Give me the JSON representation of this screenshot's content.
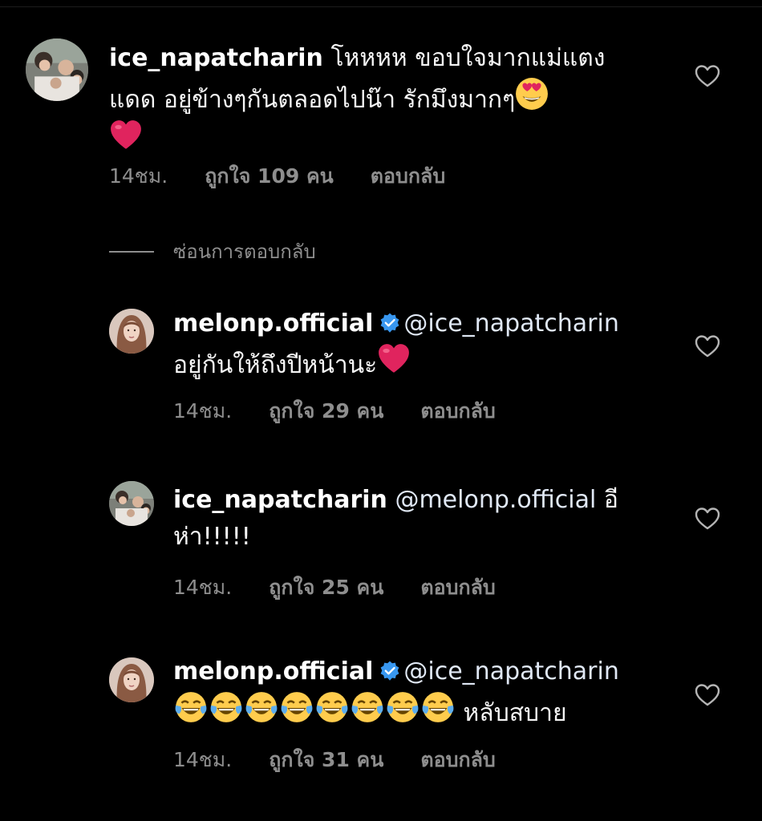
{
  "colors": {
    "background": "#000000",
    "meta_text": "#8e8e8e",
    "verified": "#3897f0",
    "heart_emoji": "#e0245e"
  },
  "comments": [
    {
      "username": "ice_napatcharin",
      "text_line1": " โหหหห ขอบใจมากแม่แตง",
      "text_line2": "แดด  อยู่ข้างๆกันตลอดไปน๊า รักมึงมากๆ",
      "time": "14ชม.",
      "likes": "ถูกใจ 109 คน",
      "reply": "ตอบกลับ",
      "emoji": [
        "heart-eyes",
        "red-heart"
      ]
    },
    {
      "username": "melonp.official",
      "verified": true,
      "mention": "@ice_napatcharin",
      "text_line2": "อยู่กันให้ถึงปีหน้านะ",
      "time": "14ชม.",
      "likes": "ถูกใจ 29 คน",
      "reply": "ตอบกลับ",
      "emoji": [
        "red-heart"
      ]
    },
    {
      "username": "ice_napatcharin",
      "mention": "@melonp.official",
      "text_line1_tail": " อี",
      "text_line2": "ห่า!!!!!",
      "time": "14ชม.",
      "likes": "ถูกใจ 25 คน",
      "reply": "ตอบกลับ"
    },
    {
      "username": "melonp.official",
      "verified": true,
      "mention": "@ice_napatcharin",
      "text_line2_tail": " หลับสบาย",
      "time": "14ชม.",
      "likes": "ถูกใจ 31 คน",
      "reply": "ตอบกลับ",
      "emoji": [
        "tears-of-joy",
        "tears-of-joy",
        "tears-of-joy",
        "tears-of-joy",
        "tears-of-joy",
        "tears-of-joy",
        "tears-of-joy",
        "tears-of-joy"
      ]
    }
  ],
  "hide_replies_label": "ซ่อนการตอบกลับ"
}
